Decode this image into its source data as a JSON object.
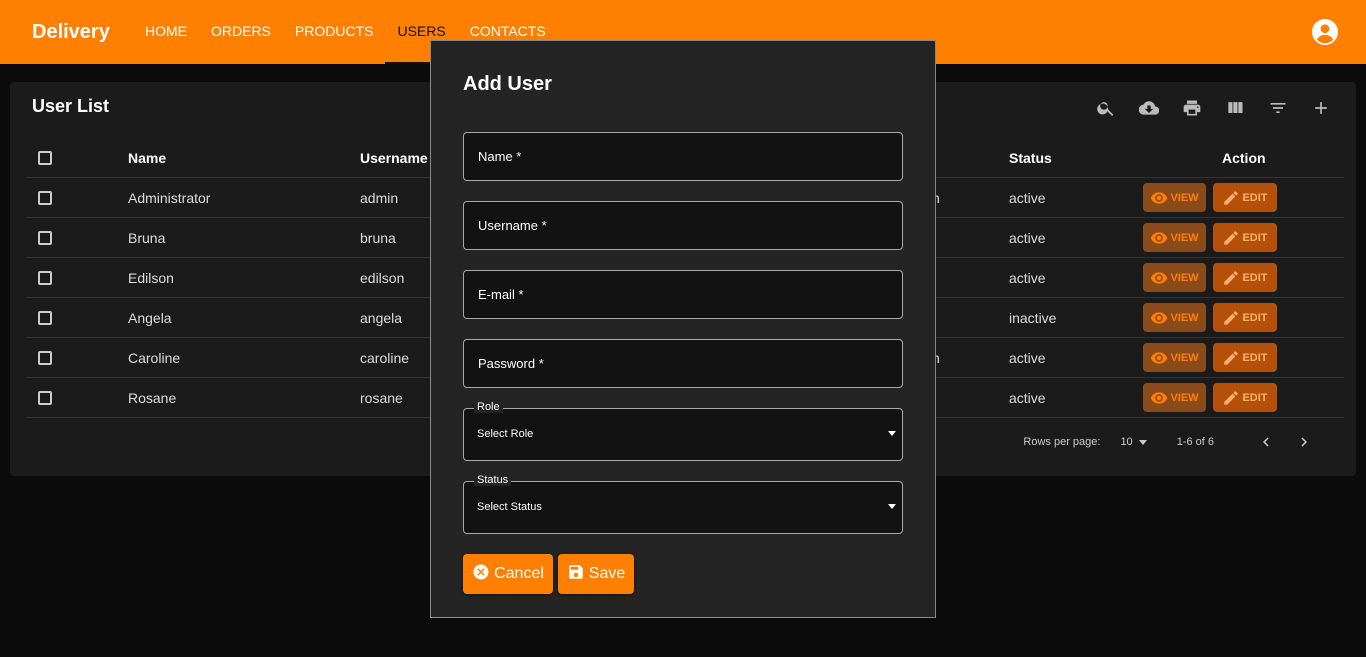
{
  "app": {
    "brand": "Delivery"
  },
  "nav": {
    "items": [
      "HOME",
      "ORDERS",
      "PRODUCTS",
      "USERS",
      "CONTACTS"
    ],
    "active": "USERS"
  },
  "list": {
    "title": "User List",
    "columns": {
      "name": "Name",
      "username": "Username",
      "status": "Status",
      "action": "Action"
    },
    "rows": [
      {
        "name": "Administrator",
        "username": "admin",
        "role_fragment": "n",
        "status": "active"
      },
      {
        "name": "Bruna",
        "username": "bruna",
        "role_fragment": "",
        "status": "active"
      },
      {
        "name": "Edilson",
        "username": "edilson",
        "role_fragment": "",
        "status": "active"
      },
      {
        "name": "Angela",
        "username": "angela",
        "role_fragment": "",
        "status": "inactive"
      },
      {
        "name": "Caroline",
        "username": "caroline",
        "role_fragment": "n",
        "status": "active"
      },
      {
        "name": "Rosane",
        "username": "rosane",
        "role_fragment": "",
        "status": "active"
      }
    ],
    "view_label": "VIEW",
    "edit_label": "EDIT",
    "pagination": {
      "rows_label": "Rows per page:",
      "rows_value": "10",
      "range": "1-6 of 6"
    }
  },
  "dialog": {
    "title": "Add User",
    "fields": {
      "name": "Name *",
      "username": "Username *",
      "email": "E-mail *",
      "password": "Password *"
    },
    "role": {
      "legend": "Role",
      "value": "Select Role"
    },
    "status": {
      "legend": "Status",
      "value": "Select Status"
    },
    "cancel_label": "Cancel",
    "save_label": "Save"
  },
  "colors": {
    "accent": "#ff7f00",
    "background": "#0b0b0b",
    "dialog": "#242424"
  }
}
